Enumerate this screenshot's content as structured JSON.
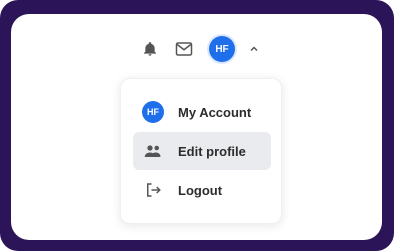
{
  "header": {
    "avatar_initials": "HF",
    "icons": [
      "bell-icon",
      "mail-icon",
      "chevron-up-icon"
    ]
  },
  "menu": {
    "items": [
      {
        "label": "My Account",
        "avatar_initials": "HF",
        "icon": "avatar"
      },
      {
        "label": "Edit profile",
        "icon": "users-icon",
        "active": true
      },
      {
        "label": "Logout",
        "icon": "logout-icon"
      }
    ]
  },
  "colors": {
    "frame": "#2b1458",
    "avatar": "#1f6feb",
    "active_item_bg": "#e9ebee",
    "text": "#2d2d2d"
  }
}
